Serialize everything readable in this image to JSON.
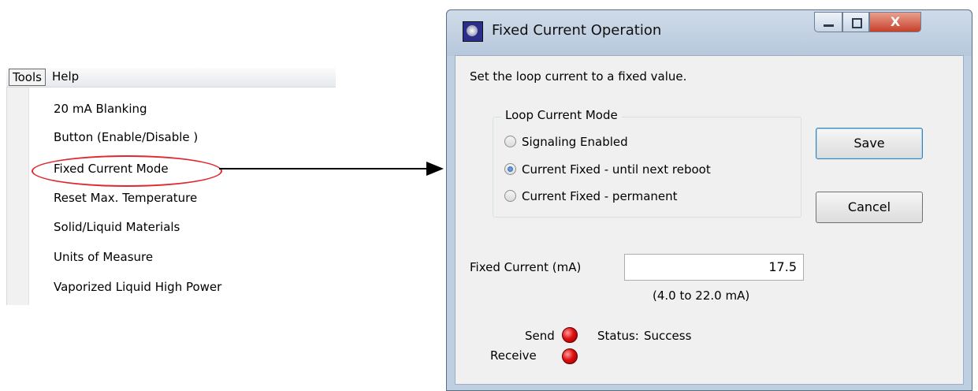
{
  "menu": {
    "menubar": {
      "tools": "Tools",
      "help": "Help"
    },
    "items": [
      "20 mA Blanking",
      "Button (Enable/Disable )",
      "Fixed Current Mode",
      "Reset Max. Temperature",
      "Solid/Liquid Materials",
      "Units of Measure",
      "Vaporized Liquid High Power"
    ],
    "highlighted_item": "Fixed Current Mode",
    "highlight_color": "#e0282e"
  },
  "dialog": {
    "title": "Fixed Current Operation",
    "title_icon": "satellite-dish-icon",
    "window_buttons": {
      "minimize": "minimize-icon",
      "maximize": "maximize-icon",
      "close": "X"
    },
    "instruction": "Set the loop current to a fixed value.",
    "group": {
      "label": "Loop Current Mode",
      "options": [
        {
          "label": "Signaling Enabled",
          "checked": false
        },
        {
          "label": "Current Fixed - until next reboot",
          "checked": true
        },
        {
          "label": "Current Fixed - permanent",
          "checked": false
        }
      ]
    },
    "buttons": {
      "save": "Save",
      "cancel": "Cancel"
    },
    "fixed_current": {
      "label": "Fixed Current (mA)",
      "value": "17.5",
      "range": "(4.0 to 22.0 mA)"
    },
    "indicators": {
      "send": "Send",
      "receive": "Receive",
      "led_color": "#e01010"
    },
    "status": {
      "label": "Status:",
      "value": "Success"
    }
  }
}
